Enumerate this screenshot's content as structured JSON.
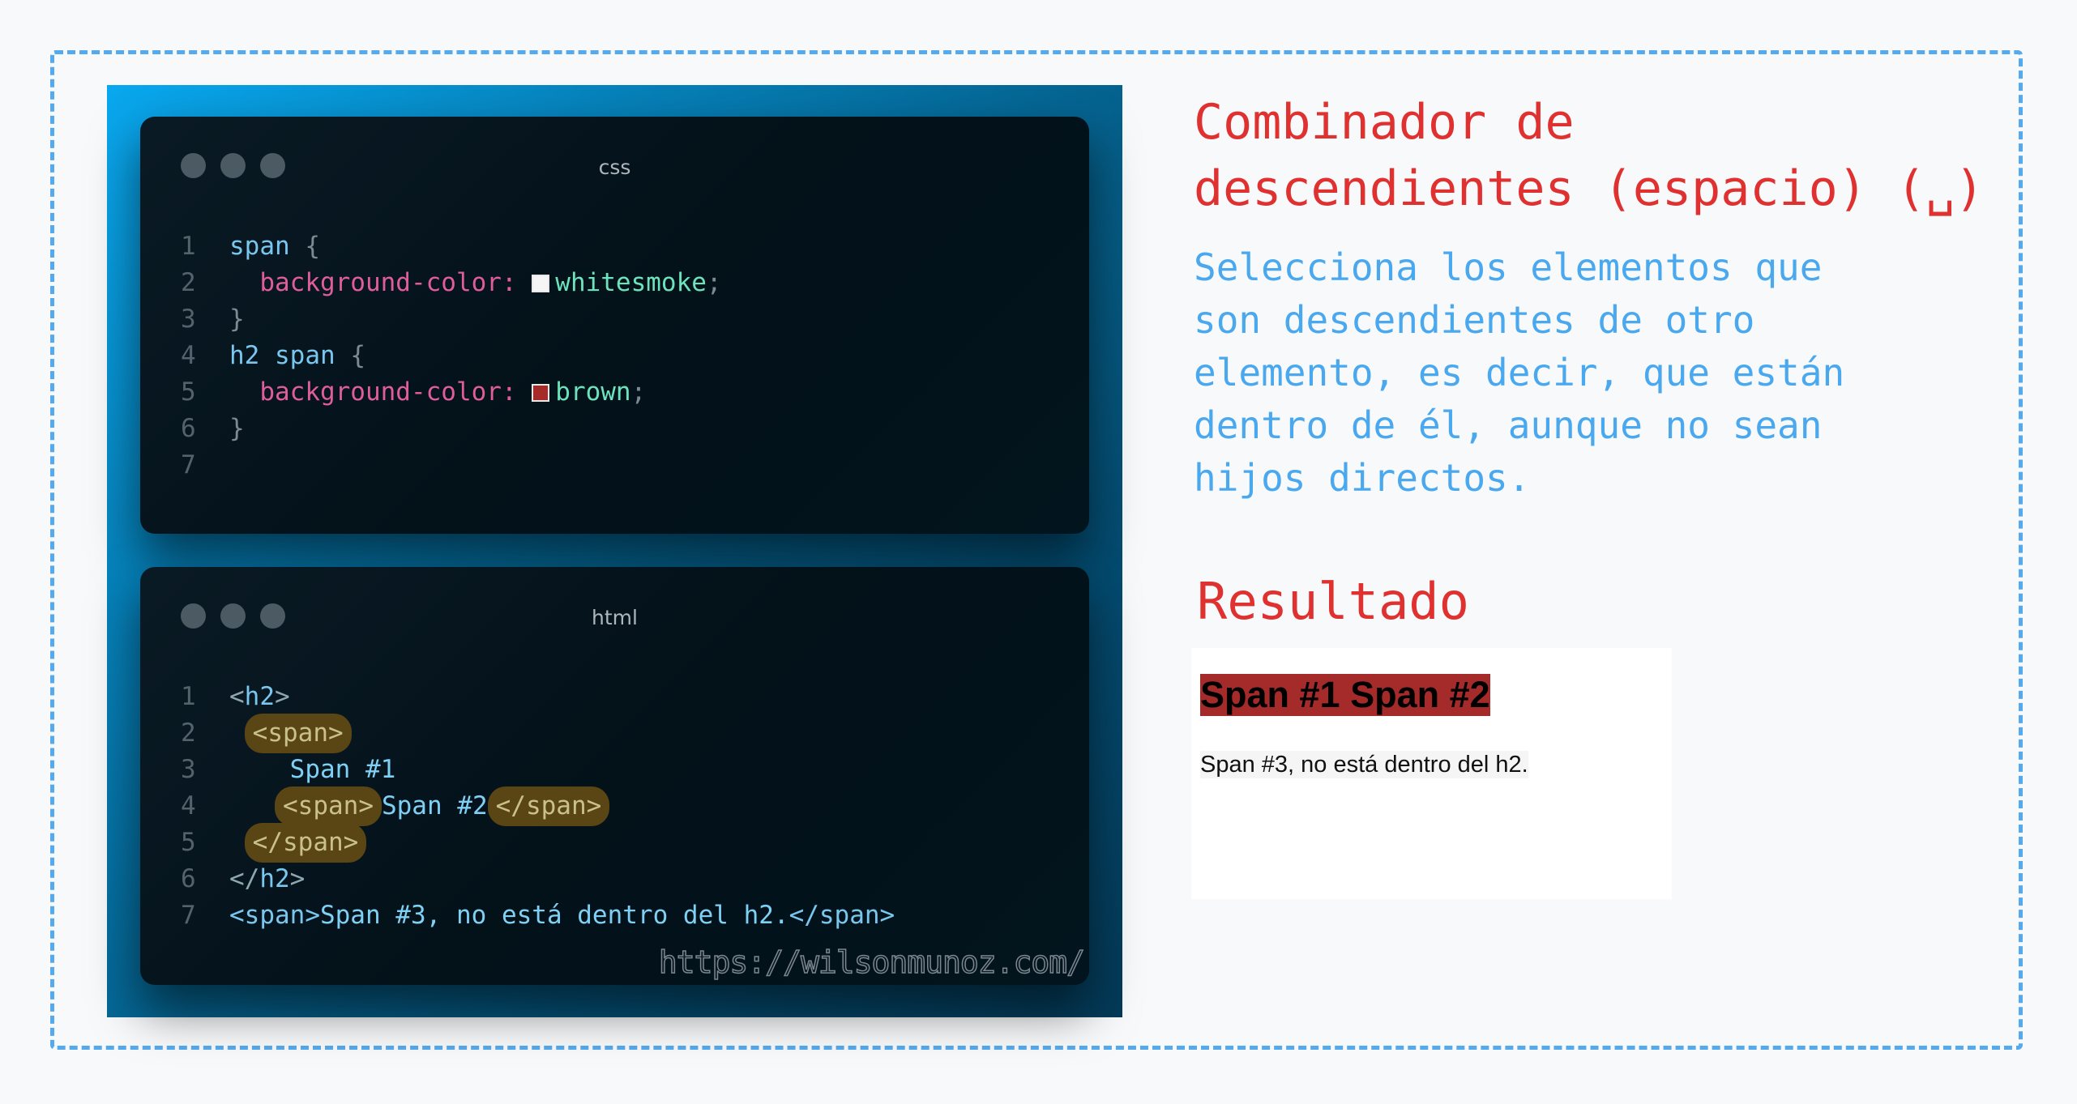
{
  "css_card": {
    "title": "css",
    "lines": [
      {
        "n": "1",
        "selector": "span",
        "brace": " {"
      },
      {
        "n": "2",
        "property": "background-color:",
        "swatch": "#f5f5f5",
        "value": "whitesmoke",
        "semi": ";"
      },
      {
        "n": "3",
        "brace": "}"
      },
      {
        "n": "4",
        "selector": "h2 span",
        "brace": " {"
      },
      {
        "n": "5",
        "property": "background-color:",
        "swatch": "#a52a2a",
        "value": "brown",
        "semi": ";"
      },
      {
        "n": "6",
        "brace": "}"
      },
      {
        "n": "7"
      }
    ]
  },
  "html_card": {
    "title": "html",
    "lines": [
      {
        "n": "1",
        "open": "<",
        "tag": "h2",
        "close": ">"
      },
      {
        "n": "2",
        "code": "<span>"
      },
      {
        "n": "3",
        "text": "Span #1"
      },
      {
        "n": "4",
        "open_tag": "<span>",
        "text": "Span #2",
        "close_tag": "</span>"
      },
      {
        "n": "5",
        "code": "</span>"
      },
      {
        "n": "6",
        "open": "</",
        "tag": "h2",
        "close": ">"
      },
      {
        "n": "7",
        "open_tag": "<span>",
        "text": "Span #3, no está dentro del h2.",
        "close_tag": "</span>"
      }
    ],
    "watermark": "https://wilsonmunoz.com/"
  },
  "explanation": {
    "title_line1": "Combinador de",
    "title_line2": "descendientes (espacio) (␣)",
    "description": [
      "Selecciona los elementos que",
      "son descendientes de otro",
      "elemento, es decir, que están",
      "dentro de él, aunque no sean",
      "hijos directos."
    ]
  },
  "result": {
    "heading": "Resultado",
    "h2_text": "Span #1 Span #2",
    "span3_text": "Span #3, no está dentro del h2.",
    "colors": {
      "h2_span_bg": "#a52a2a",
      "span_bg": "#f5f5f5"
    }
  },
  "colors": {
    "accent_red": "#e03131",
    "accent_blue": "#4aa8ee",
    "border_blue": "#55aaee"
  }
}
